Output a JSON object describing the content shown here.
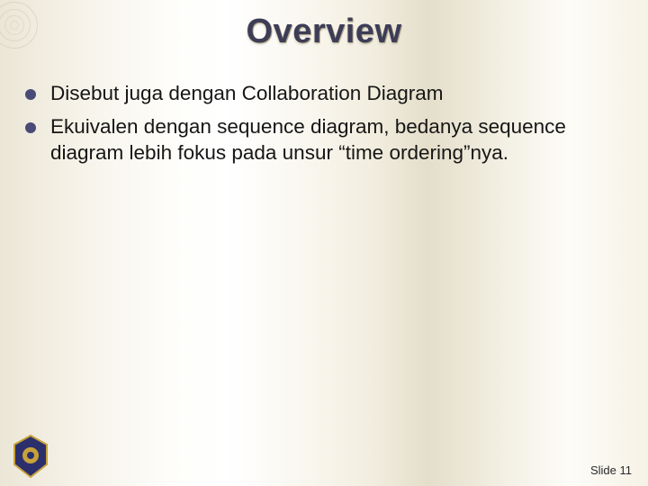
{
  "slide": {
    "title": "Overview",
    "bullets": [
      "Disebut juga dengan Collaboration Diagram",
      "Ekuivalen dengan sequence diagram, bedanya sequence diagram lebih fokus pada unsur “time ordering”nya."
    ],
    "footer": "Slide 11"
  }
}
